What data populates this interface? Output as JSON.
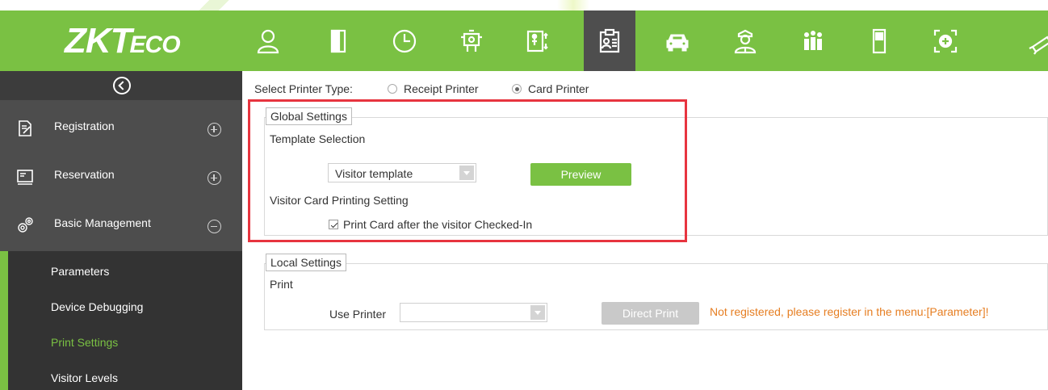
{
  "header": {
    "logo_main": "ZKT",
    "logo_suffix": "ECO",
    "brand_color": "#7ac143",
    "nav_icons": [
      "personnel-icon",
      "access-door-icon",
      "attendance-clock-icon",
      "elevator-icon",
      "entrance-icon",
      "visitor-card-icon",
      "parking-car-icon",
      "patrol-guard-icon",
      "consumption-people-icon",
      "ifr-device-icon",
      "video-icon",
      "camera-icon"
    ],
    "active_nav": "visitor-card-icon"
  },
  "sidebar": {
    "collapse_icon": "collapse-left-icon",
    "items": [
      {
        "label": "Registration",
        "icon": "registration-icon",
        "toggle": "plus"
      },
      {
        "label": "Reservation",
        "icon": "reservation-icon",
        "toggle": "plus"
      },
      {
        "label": "Basic Management",
        "icon": "gears-icon",
        "toggle": "minus"
      }
    ],
    "sub_items": [
      {
        "label": "Parameters",
        "active": false
      },
      {
        "label": "Device Debugging",
        "active": false
      },
      {
        "label": "Print Settings",
        "active": true
      },
      {
        "label": "Visitor Levels",
        "active": false
      }
    ]
  },
  "main": {
    "printer_type_label": "Select Printer Type:",
    "printer_options": [
      {
        "label": "Receipt Printer",
        "checked": false
      },
      {
        "label": "Card Printer",
        "checked": true
      }
    ],
    "global_settings": {
      "legend": "Global Settings",
      "template_selection_label": "Template Selection",
      "template_value": "Visitor template",
      "preview_button": "Preview",
      "card_printing_label": "Visitor Card Printing Setting",
      "print_after_checkin_label": "Print Card after the visitor Checked-In",
      "print_after_checkin_checked": true
    },
    "local_settings": {
      "legend": "Local Settings",
      "print_label": "Print",
      "use_printer_label": "Use Printer",
      "use_printer_value": "",
      "direct_print_button": "Direct Print",
      "warning": "Not registered, please register in the menu:[Parameter]!"
    }
  }
}
